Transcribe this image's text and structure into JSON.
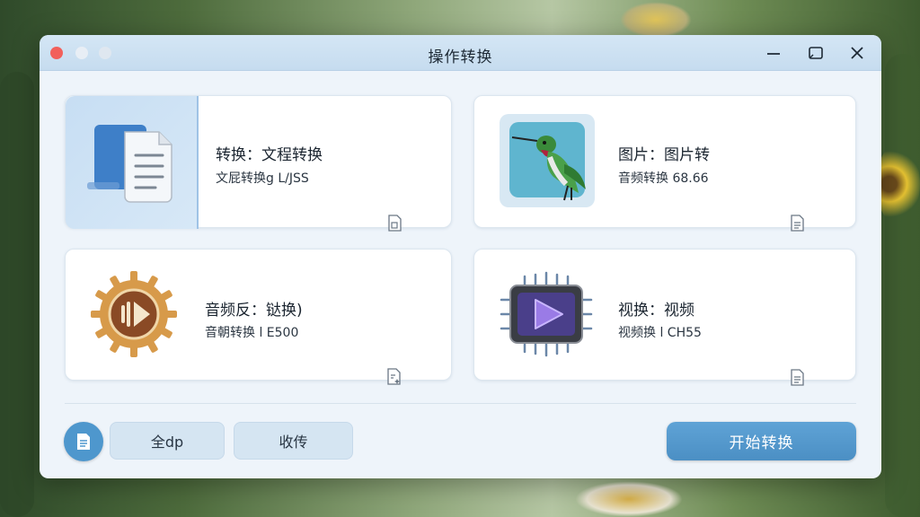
{
  "window": {
    "title": "操作转换"
  },
  "cards": [
    {
      "title": "转换：文程转换",
      "subtitle": "文屁转换g L/JSS",
      "icon": "document-copy-icon",
      "corner_icon": "file-badge-icon"
    },
    {
      "title": "图片：图片转",
      "subtitle": "音频转换 68.66",
      "icon": "hummingbird-image-icon",
      "corner_icon": "file-lines-icon"
    },
    {
      "title": "音频反：𫟼换)",
      "subtitle": "音朝转换 l E500",
      "icon": "audio-gear-icon",
      "corner_icon": "file-sparkle-icon"
    },
    {
      "title": "视换：视频",
      "subtitle": "视频换 l CH55",
      "icon": "video-chip-play-icon",
      "corner_icon": "file-lines-icon"
    }
  ],
  "footer": {
    "list_button_icon": "list-file-icon",
    "all_label": "全dp",
    "favorites_label": "收传",
    "start_label": "开始转换"
  },
  "colors": {
    "accent": "#4e97cd",
    "close_dot": "#f2605b",
    "titlebar": "#c6dcef"
  }
}
